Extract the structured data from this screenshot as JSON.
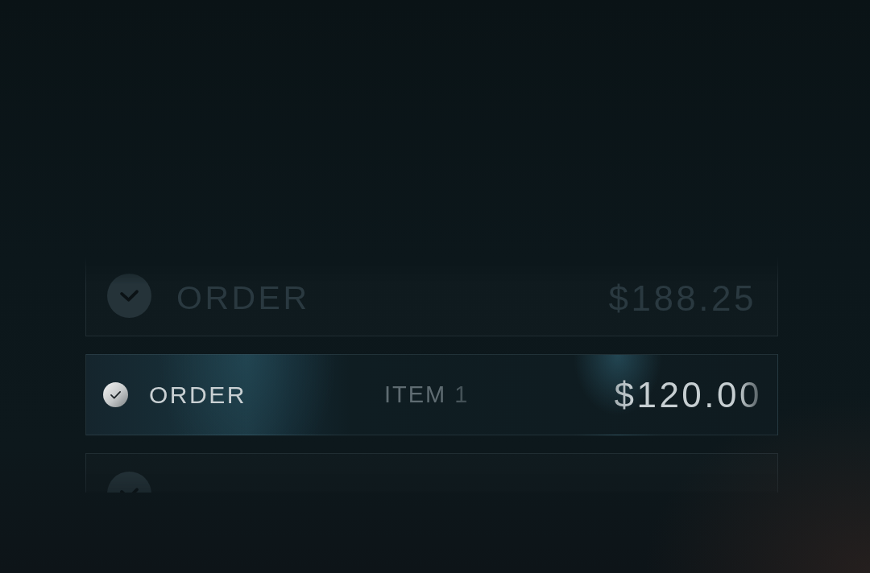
{
  "orders": [
    {
      "label": "ORDER",
      "amount": "$188.25",
      "selected": false
    },
    {
      "label": "ORDER",
      "item": "ITEM 1",
      "amount": "$120.00",
      "selected": true
    },
    {
      "selected": false
    }
  ]
}
